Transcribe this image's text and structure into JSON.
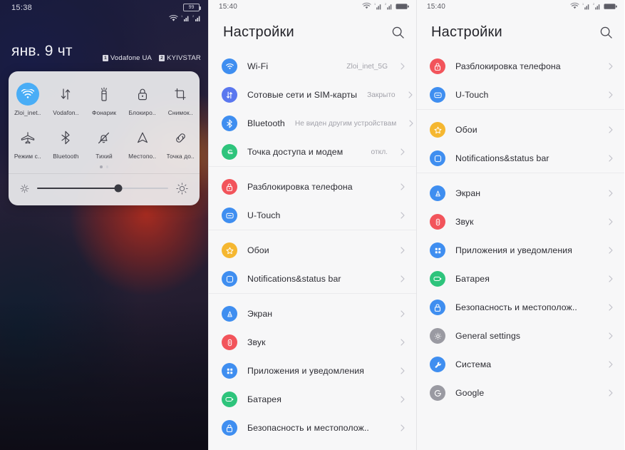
{
  "panel_lock": {
    "status_bar": {
      "time": "15:38",
      "battery_percent": "99",
      "icons": [
        "wifi-icon",
        "signal-sim1-icon",
        "signal-sim2-icon"
      ]
    },
    "date": "янв. 9 чт",
    "carriers": [
      {
        "sim": "1",
        "name": "Vodafone UA"
      },
      {
        "sim": "2",
        "name": "KYIVSTAR"
      }
    ],
    "quick_tiles_page1": [
      {
        "label": "Zloi_inet..",
        "icon": "wifi-icon",
        "active": true
      },
      {
        "label": "Vodafon..",
        "icon": "mobile-data-icon",
        "active": false
      },
      {
        "label": "Фонарик",
        "icon": "flashlight-icon",
        "active": false
      },
      {
        "label": "Блокиро..",
        "icon": "lock-rotation-icon",
        "active": false
      },
      {
        "label": "Снимок..",
        "icon": "screenshot-icon",
        "active": false
      }
    ],
    "quick_tiles_page2": [
      {
        "label": "Режим с..",
        "icon": "airplane-icon",
        "active": false
      },
      {
        "label": "Bluetooth",
        "icon": "bluetooth-icon",
        "active": false
      },
      {
        "label": "Тихий",
        "icon": "mute-bell-icon",
        "active": false
      },
      {
        "label": "Местопо..",
        "icon": "location-icon",
        "active": false
      },
      {
        "label": "Точка до..",
        "icon": "link-hotspot-icon",
        "active": false
      }
    ],
    "pager": {
      "pages": 2,
      "current": 1
    },
    "brightness": {
      "left_icon": "brightness-low-icon",
      "right_icon": "brightness-high-icon",
      "value_percent": 62
    }
  },
  "panel_settings_top": {
    "status_bar": {
      "time": "15:40",
      "icons": [
        "wifi-icon",
        "signal-sim1-icon",
        "signal-sim2-icon",
        "battery-icon"
      ]
    },
    "title": "Настройки",
    "search_icon": "search-icon",
    "groups": [
      {
        "items": [
          {
            "label": "Wi-Fi",
            "value": "Zloi_inet_5G",
            "icon": "wifi-icon",
            "color": "#3f8ef0"
          },
          {
            "label": "Сотовые сети и SIM-карты",
            "value": "Закрыто",
            "icon": "mobile-data-icon",
            "color": "#5a77ef"
          },
          {
            "label": "Bluetooth",
            "value": "Не виден другим устройствам",
            "icon": "bluetooth-icon",
            "color": "#3f8ef0"
          },
          {
            "label": "Точка доступа и модем",
            "value": "откл.",
            "icon": "hotspot-icon",
            "color": "#2ec47c"
          }
        ]
      },
      {
        "items": [
          {
            "label": "Разблокировка телефона",
            "value": "",
            "icon": "unlock-icon",
            "color": "#f2545b"
          },
          {
            "label": "U-Touch",
            "value": "",
            "icon": "utouch-icon",
            "color": "#3f8ef0"
          }
        ]
      },
      {
        "items": [
          {
            "label": "Обои",
            "value": "",
            "icon": "wallpaper-star-icon",
            "color": "#f5b731"
          },
          {
            "label": "Notifications&status bar",
            "value": "",
            "icon": "notifications-icon",
            "color": "#3f8ef0"
          }
        ]
      },
      {
        "items": [
          {
            "label": "Экран",
            "value": "",
            "icon": "display-icon",
            "color": "#3f8ef0"
          },
          {
            "label": "Звук",
            "value": "",
            "icon": "sound-icon",
            "color": "#f2545b"
          },
          {
            "label": "Приложения и уведомления",
            "value": "",
            "icon": "apps-icon",
            "color": "#3f8ef0"
          },
          {
            "label": "Батарея",
            "value": "",
            "icon": "battery-icon",
            "color": "#2ec47c"
          },
          {
            "label": "Безопасность и местополож..",
            "value": "",
            "icon": "security-lock-icon",
            "color": "#3f8ef0"
          }
        ]
      }
    ]
  },
  "panel_settings_scrolled": {
    "status_bar": {
      "time": "15:40",
      "icons": [
        "wifi-icon",
        "signal-sim1-icon",
        "signal-sim2-icon",
        "battery-icon"
      ]
    },
    "title": "Настройки",
    "search_icon": "search-icon",
    "groups": [
      {
        "items": [
          {
            "label": "Разблокировка телефона",
            "value": "",
            "icon": "unlock-icon",
            "color": "#f2545b"
          },
          {
            "label": "U-Touch",
            "value": "",
            "icon": "utouch-icon",
            "color": "#3f8ef0"
          }
        ]
      },
      {
        "items": [
          {
            "label": "Обои",
            "value": "",
            "icon": "wallpaper-star-icon",
            "color": "#f5b731"
          },
          {
            "label": "Notifications&status bar",
            "value": "",
            "icon": "notifications-icon",
            "color": "#3f8ef0"
          }
        ]
      },
      {
        "items": [
          {
            "label": "Экран",
            "value": "",
            "icon": "display-icon",
            "color": "#3f8ef0"
          },
          {
            "label": "Звук",
            "value": "",
            "icon": "sound-icon",
            "color": "#f2545b"
          },
          {
            "label": "Приложения и уведомления",
            "value": "",
            "icon": "apps-icon",
            "color": "#3f8ef0"
          },
          {
            "label": "Батарея",
            "value": "",
            "icon": "battery-icon",
            "color": "#2ec47c"
          },
          {
            "label": "Безопасность и местополож..",
            "value": "",
            "icon": "security-lock-icon",
            "color": "#3f8ef0"
          },
          {
            "label": "General settings",
            "value": "",
            "icon": "gear-icon",
            "color": "#9a9aa2"
          },
          {
            "label": "Система",
            "value": "",
            "icon": "wrench-icon",
            "color": "#3f8ef0"
          },
          {
            "label": "Google",
            "value": "",
            "icon": "google-icon",
            "color": "#9a9aa2"
          }
        ]
      }
    ]
  },
  "colors": {
    "accent_blue": "#3f8ef0",
    "accent_red": "#f2545b",
    "accent_green": "#2ec47c",
    "accent_yellow": "#f5b731",
    "accent_grey": "#9a9aa2",
    "tile_active": "#49adf6",
    "panel_bg": "#f7f7f8"
  }
}
